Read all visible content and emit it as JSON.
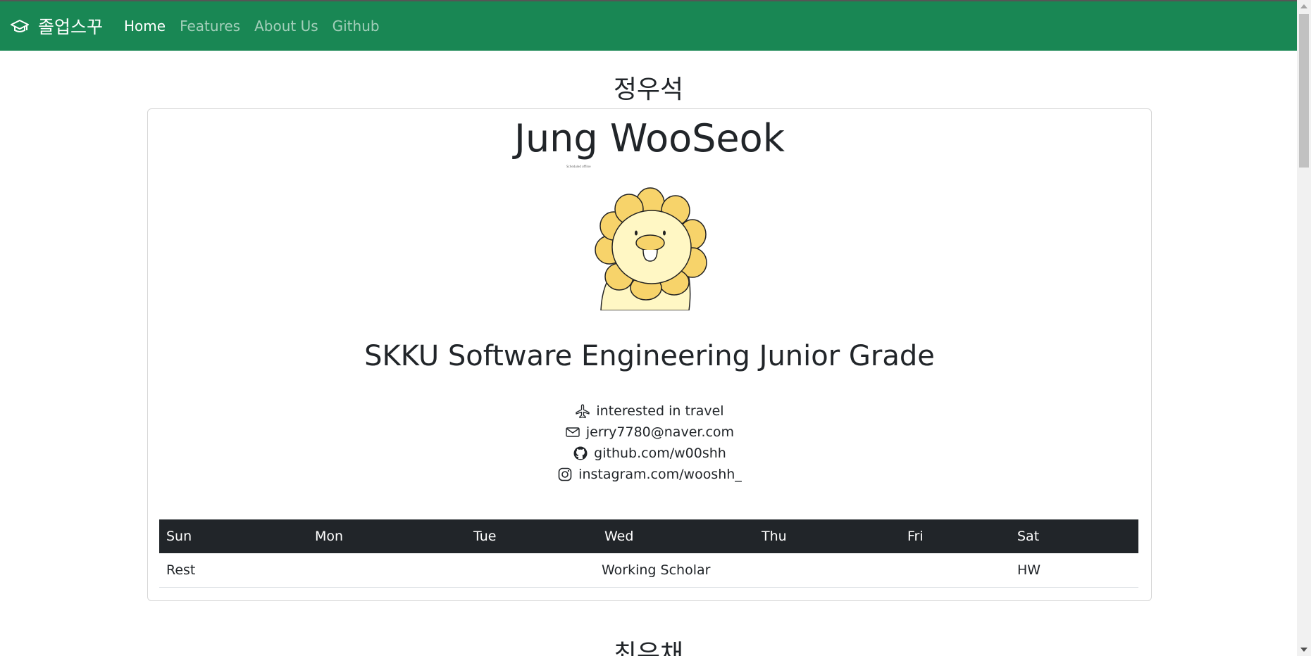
{
  "navbar": {
    "brand_icon": "graduation-cap-icon",
    "brand": "졸업스꾸",
    "links": [
      {
        "label": "Home",
        "active": true
      },
      {
        "label": "Features",
        "active": false
      },
      {
        "label": "About Us",
        "active": false
      },
      {
        "label": "Github",
        "active": false
      }
    ],
    "color": "#198754"
  },
  "profile": {
    "section_title": "정우석",
    "name": "Jung WooSeok",
    "tiny_caption": "Scheduled offline",
    "avatar_icon": "sunflower-lion-character",
    "subtitle": "SKKU Software Engineering Junior Grade",
    "info": [
      {
        "icon": "airplane-icon",
        "text": "interested in travel"
      },
      {
        "icon": "envelope-icon",
        "text": "jerry7780@naver.com"
      },
      {
        "icon": "github-icon",
        "text": "github.com/w00shh"
      },
      {
        "icon": "instagram-icon",
        "text": "instagram.com/wooshh_"
      }
    ],
    "schedule": {
      "headers": [
        "Sun",
        "Mon",
        "Tue",
        "Wed",
        "Thu",
        "Fri",
        "Sat"
      ],
      "rows": [
        [
          "Rest",
          "",
          "",
          "Working Scholar",
          "",
          "",
          "HW"
        ]
      ]
    }
  },
  "next_section_title": "최유채"
}
